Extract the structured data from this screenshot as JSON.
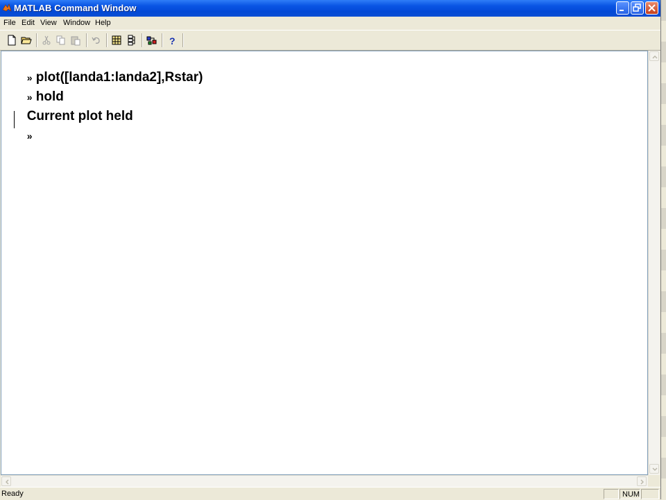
{
  "window": {
    "title": "MATLAB Command Window"
  },
  "menu": {
    "items": [
      {
        "label": "File"
      },
      {
        "label": "Edit"
      },
      {
        "label": "View"
      },
      {
        "label": "Window"
      },
      {
        "label": "Help"
      }
    ]
  },
  "toolbar": {
    "buttons": [
      {
        "icon": "new-file-icon"
      },
      {
        "icon": "open-folder-icon"
      },
      {
        "icon": "cut-icon",
        "enabled": false
      },
      {
        "icon": "copy-icon",
        "enabled": false
      },
      {
        "icon": "paste-icon",
        "enabled": false
      },
      {
        "icon": "undo-icon",
        "enabled": false
      },
      {
        "icon": "workspace-browser-icon"
      },
      {
        "icon": "path-browser-icon"
      },
      {
        "icon": "simulink-icon"
      },
      {
        "icon": "help-icon",
        "label": "?"
      }
    ]
  },
  "console": {
    "lines": [
      {
        "prompt": "»",
        "text": "plot([landa1:landa2],Rstar)"
      },
      {
        "prompt": "»",
        "text": "hold"
      },
      {
        "prompt": "",
        "text": "Current plot held"
      },
      {
        "prompt": "»",
        "text": ""
      }
    ]
  },
  "status": {
    "text": "Ready",
    "num": "NUM"
  },
  "colors": {
    "titlebar": "#0A55E4",
    "window_bg": "#ECE9D8",
    "console_bg": "#FFFFFF"
  }
}
